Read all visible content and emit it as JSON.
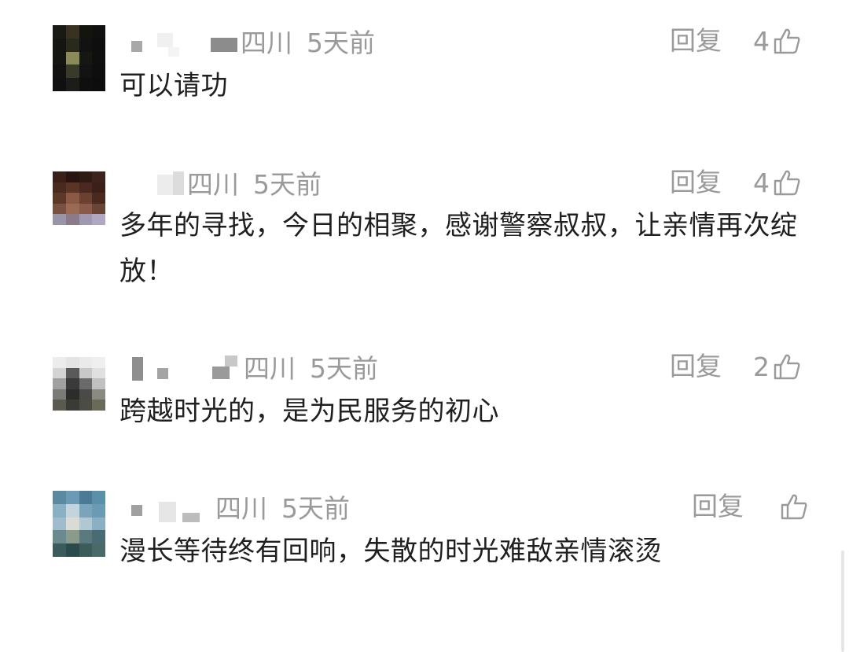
{
  "reply_label": "回复",
  "comments": [
    {
      "region": "四川",
      "time": "5天前",
      "likes": "4",
      "text": "可以请功"
    },
    {
      "region": "四川",
      "time": "5天前",
      "likes": "4",
      "text": "多年的寻找，今日的相聚，感谢警察叔叔，让亲情再次绽放！"
    },
    {
      "region": "四川",
      "time": "5天前",
      "likes": "2",
      "text": "跨越时光的，是为民服务的初心"
    },
    {
      "region": "四川",
      "time": "5天前",
      "likes": "",
      "text": "漫长等待终有回响，失散的时光难敌亲情滚烫"
    }
  ],
  "icons": {
    "like": "thumbs-up-icon"
  },
  "colors": {
    "meta_text": "#9a9a9a",
    "body_text": "#1f1f1f",
    "background": "#ffffff"
  }
}
